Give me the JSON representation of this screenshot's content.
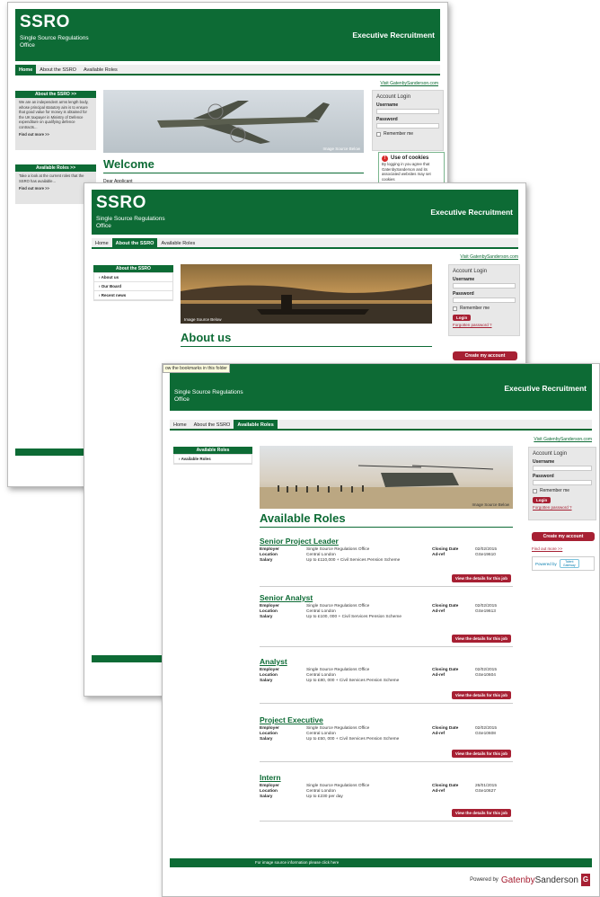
{
  "site": {
    "logo": "SSRO",
    "subtitle": "Single Source Regulations Office",
    "exec": "Executive Recruitment",
    "visit_link": "Visit GatenbySanderson.com",
    "nav": [
      "Home",
      "About the SSRO",
      "Available Roles"
    ]
  },
  "login": {
    "title": "Account Login",
    "username": "Username",
    "password": "Password",
    "remember": "Remember me",
    "login_btn": "Login",
    "forgot": "Forgotten password ?"
  },
  "page1": {
    "welcome": "Welcome",
    "intro_snippet": "Dear Applicant",
    "image_caption": "Image Source Below",
    "about_head": "About the SSRO >>",
    "about_text": "We are an independent arms length body, whose principal statutory aim is to ensure that good value for money is obtained for the UK taxpayer in Ministry of Defence expenditure on qualifying defence contracts...",
    "find_more": "Find out more >>",
    "roles_head": "Available Roles >>",
    "roles_text": "Take a look at the current roles that the SSRO has available...",
    "cookie_title": "Use of cookies",
    "cookie_text": "By logging in you agree that GatenbySanderson and its associated websites may set cookies"
  },
  "page2": {
    "title": "About us",
    "sidebar_head": "About the SSRO",
    "sidebar_items": [
      "About us",
      "Our Board",
      "Recent news"
    ],
    "image_caption": "Image Source Below",
    "create_btn": "Create my account"
  },
  "page3": {
    "tooltip": "ow the bookmarks in this folder",
    "title": "Available Roles",
    "sidebar_head": "Available Roles",
    "sidebar_items": [
      "Available Roles"
    ],
    "image_caption": "Image Source Below",
    "create_btn": "Create my account",
    "find_more": "Find out more >>",
    "powered_box": "Powered by",
    "powered_box_logo": "Talent Gateway",
    "source_bar": "For image source information please click here",
    "powered_by": "Powered by",
    "gs_part1": "Gatenby",
    "gs_part2": "Sanderson",
    "gs_logo": "G",
    "labels": {
      "employer": "Employer",
      "location": "Location",
      "salary": "Salary",
      "closing": "Closing Date",
      "adref": "Ad-ref",
      "view": "View the details for this job"
    },
    "roles": [
      {
        "title": "Senior Project Leader",
        "employer": "Single Source Regulations Office",
        "location": "Central London",
        "salary": "Up to £110,000 + Civil Services Pension Scheme",
        "closing": "02/02/2015",
        "adref": "GSe19610"
      },
      {
        "title": "Senior Analyst",
        "employer": "Single Source Regulations Office",
        "location": "Central London",
        "salary": "Up to £100, 000 + Civil Services Pension Scheme",
        "closing": "02/02/2015",
        "adref": "GSe19613"
      },
      {
        "title": "Analyst",
        "employer": "Single Source Regulations Office",
        "location": "Central London",
        "salary": "Up to £80, 000 + Civil Services Pension Scheme",
        "closing": "02/02/2015",
        "adref": "GSe10604"
      },
      {
        "title": "Project Executive",
        "employer": "Single Source Regulations Office",
        "location": "Central London",
        "salary": "Up to £50, 000 + Civil Services Pension Scheme",
        "closing": "02/02/2015",
        "adref": "GSe10608"
      },
      {
        "title": "Intern",
        "employer": "Single Source Regulations Office",
        "location": "Central London",
        "salary": "Up to £230 per day",
        "closing": "26/01/2015",
        "adref": "GSe10627"
      }
    ]
  },
  "colors": {
    "brand_green": "#0d6b35",
    "accent_red": "#a72033",
    "sidebar_grey": "#e4e4e4"
  }
}
